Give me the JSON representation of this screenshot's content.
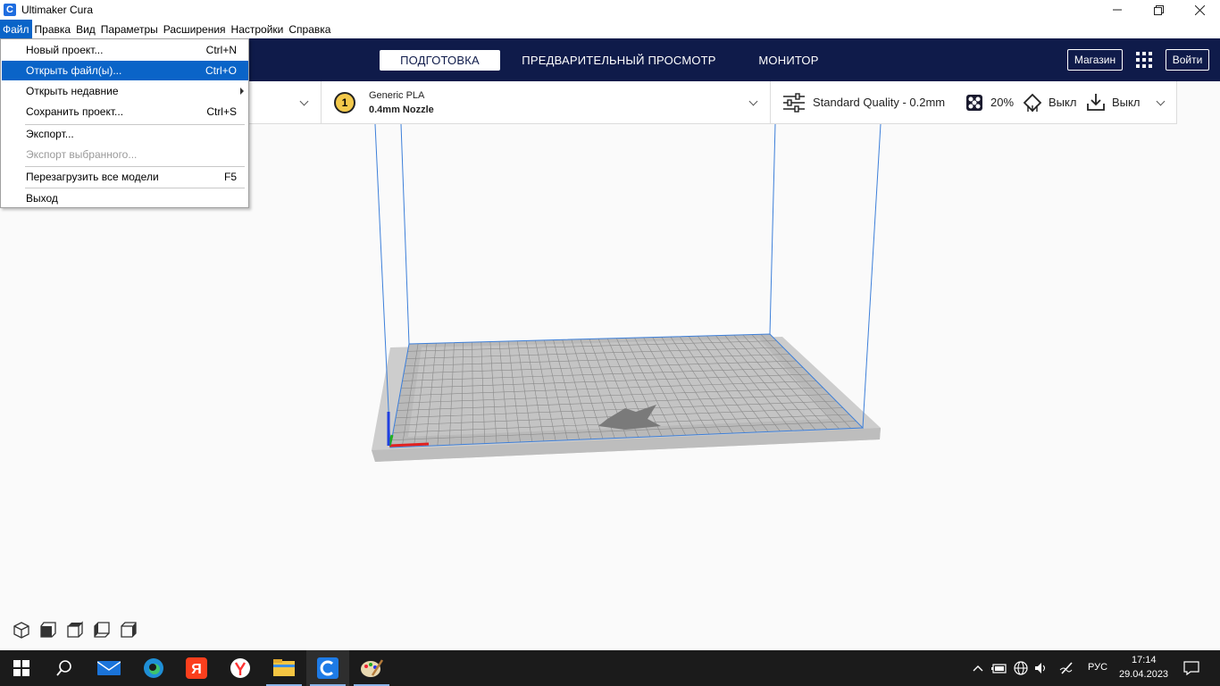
{
  "window": {
    "title": "Ultimaker Cura",
    "app_icon_glyph": "C",
    "minimize_icon": "minimize-icon",
    "restore_icon": "restore-icon",
    "close_icon": "close-icon"
  },
  "menubar": {
    "items": [
      "Файл",
      "Правка",
      "Вид",
      "Параметры",
      "Расширения",
      "Настройки",
      "Справка"
    ],
    "active_index": 0
  },
  "file_menu": {
    "items": [
      {
        "label": "Новый проект...",
        "shortcut": "Ctrl+N",
        "state": "normal"
      },
      {
        "label": "Открыть файл(ы)...",
        "shortcut": "Ctrl+O",
        "state": "highlighted"
      },
      {
        "label": "Открыть недавние",
        "shortcut": "",
        "state": "submenu"
      },
      {
        "label": "Сохранить проект...",
        "shortcut": "Ctrl+S",
        "state": "normal"
      },
      {
        "label": "Экспорт...",
        "shortcut": "",
        "state": "normal"
      },
      {
        "label": "Экспорт выбранного...",
        "shortcut": "",
        "state": "disabled"
      },
      {
        "label": "Перезагрузить все модели",
        "shortcut": "F5",
        "state": "normal"
      },
      {
        "label": "Выход",
        "shortcut": "",
        "state": "normal"
      }
    ]
  },
  "header": {
    "stages": [
      "ПОДГОТОВКА",
      "ПРЕДВАРИТЕЛЬНЫЙ ПРОСМОТР",
      "МОНИТОР"
    ],
    "active_stage": 0,
    "marketplace_label": "Магазин",
    "signin_label": "Войти",
    "apps_icon": "apps-grid-icon"
  },
  "config": {
    "extruder_number": "1",
    "material": "Generic PLA",
    "nozzle": "0.4mm Nozzle",
    "quality": "Standard Quality - 0.2mm",
    "infill": "20%",
    "support": "Выкл",
    "adhesion": "Выкл"
  },
  "colors": {
    "header_bg": "#0f1b4a",
    "menu_highlight": "#0a64c8",
    "volume_outline": "#3d7fd9",
    "bed": "#d4d4d4",
    "axis_x": "#e02020",
    "axis_y": "#20b020",
    "axis_z": "#2040e0"
  },
  "view_buttons": [
    "view-3d-icon",
    "view-front-icon",
    "view-top-icon",
    "view-left-icon",
    "view-right-icon"
  ],
  "taskbar": {
    "apps": [
      "start-icon",
      "search-icon",
      "mail-icon",
      "edge-icon",
      "yandex-icon",
      "yandex-browser-icon",
      "explorer-icon",
      "cura-icon",
      "paint-icon"
    ],
    "language": "РУС",
    "time": "17:14",
    "date": "29.04.2023"
  }
}
